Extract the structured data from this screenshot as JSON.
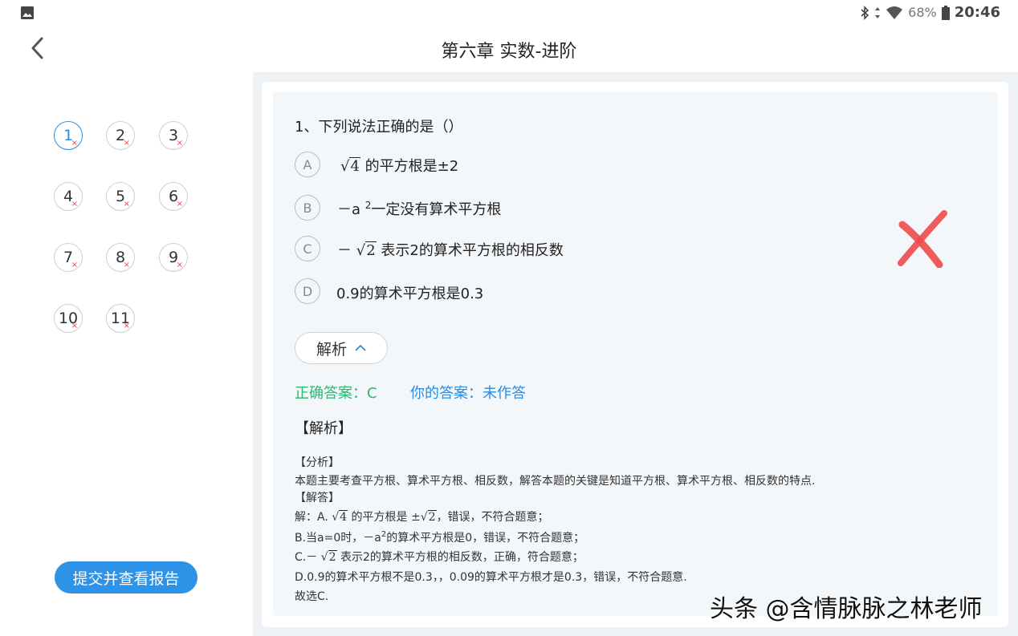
{
  "status_bar": {
    "battery": "68%",
    "time": "20:46"
  },
  "header": {
    "title": "第六章 实数-进阶"
  },
  "question_nav": {
    "items": [
      {
        "num": "1",
        "mark": "×"
      },
      {
        "num": "2",
        "mark": "×"
      },
      {
        "num": "3",
        "mark": "×"
      },
      {
        "num": "4",
        "mark": "×"
      },
      {
        "num": "5",
        "mark": "×"
      },
      {
        "num": "6",
        "mark": "×"
      },
      {
        "num": "7",
        "mark": "×"
      },
      {
        "num": "8",
        "mark": "×"
      },
      {
        "num": "9",
        "mark": "×"
      },
      {
        "num": "10",
        "mark": "×"
      },
      {
        "num": "11",
        "mark": "×"
      }
    ],
    "submit_label": "提交并查看报告"
  },
  "question": {
    "title": "1、下列说法正确的是（）",
    "options": [
      {
        "letter": "A",
        "radicand": "4",
        "text": "的平方根是±2"
      },
      {
        "letter": "B",
        "prefix": "－a",
        "sup": "2",
        "text": "一定没有算术平方根"
      },
      {
        "letter": "C",
        "prefix": "－",
        "radicand": "2",
        "text": "表示2的算术平方根的相反数"
      },
      {
        "letter": "D",
        "text": "0.9的算术平方根是0.3"
      }
    ]
  },
  "analysis": {
    "button_label": "解析",
    "correct_label": "正确答案：C",
    "your_label": "你的答案：未作答",
    "heading": "【解析】",
    "fenxi": "【分析】",
    "fenxi_text": "本题主要考查平方根、算术平方根、相反数，解答本题的关键是知道平方根、算术平方根、相反数的特点.",
    "jieda": "【解答】",
    "line_a_1": "解：A.",
    "line_a_rad1": "4",
    "line_a_2": "的平方根是",
    "line_a_pm": "±",
    "line_a_rad2": "2",
    "line_a_3": "，错误，不符合题意；",
    "line_b_1": "B.当a=0时，－a",
    "line_b_sup": "2",
    "line_b_2": "的算术平方根是0，错误，不符合题意；",
    "line_c_1": "C.－",
    "line_c_rad": "2",
    "line_c_2": "表示2的算术平方根的相反数，正确，符合题意；",
    "line_d": "D.0.9的算术平方根不是0.3，，0.09的算术平方根才是0.3，错误，不符合题意.",
    "conclusion": "故选C."
  },
  "watermark": "头条 @含情脉脉之林老师",
  "colors": {
    "accent": "#2e93e6",
    "correct": "#2bb673",
    "wrong": "#f04a4a",
    "panel_bg": "#eef1f5"
  }
}
